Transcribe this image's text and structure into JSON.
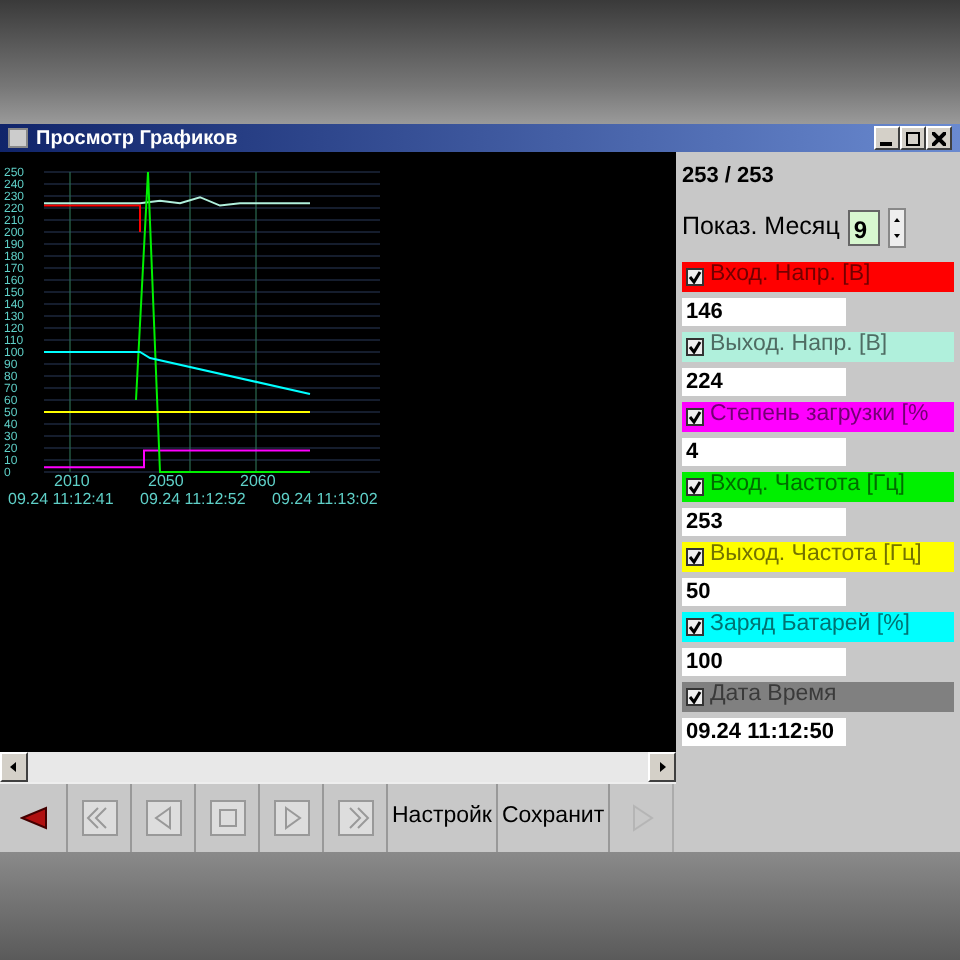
{
  "window": {
    "title": "Просмотр Графиков"
  },
  "chart": {
    "y_labels": [
      "250",
      "240",
      "230",
      "220",
      "210",
      "200",
      "190",
      "180",
      "170",
      "160",
      "150",
      "140",
      "130",
      "120",
      "110",
      "100",
      "90",
      "80",
      "70",
      "60",
      "50",
      "40",
      "30",
      "20",
      "10",
      "0"
    ],
    "x_labels": [
      "2010",
      "2050",
      "2060"
    ],
    "time_labels": [
      "09.24 11:12:41",
      "09.24 11:12:52",
      "09.24 11:13:02"
    ]
  },
  "counter": "253 / 253",
  "month": {
    "label": "Показ. Месяц",
    "value": "9"
  },
  "channels": [
    {
      "label": "Вход. Напр. [В]",
      "color": "#ff0000",
      "checked": true,
      "value": "146"
    },
    {
      "label": "Выход. Напр. [В]",
      "color": "#b0f0dc",
      "checked": true,
      "value": "224"
    },
    {
      "label": "Степень загрузки [%",
      "color": "#ff00ff",
      "checked": true,
      "value": "4"
    },
    {
      "label": "Вход. Частота [Гц]",
      "color": "#00f000",
      "checked": true,
      "value": "253"
    },
    {
      "label": "Выход. Частота [Гц]",
      "color": "#ffff00",
      "checked": true,
      "value": "50"
    },
    {
      "label": "Заряд Батарей [%]",
      "color": "#00ffff",
      "checked": true,
      "value": "100"
    },
    {
      "label": "Дата Время",
      "color": "#808080",
      "checked": true,
      "value": "09.24 11:12:50"
    }
  ],
  "toolbar": [
    {
      "kind": "back"
    },
    {
      "kind": "first"
    },
    {
      "kind": "prev"
    },
    {
      "kind": "stop"
    },
    {
      "kind": "next"
    },
    {
      "kind": "last"
    },
    {
      "kind": "text",
      "label": "Настройк"
    },
    {
      "kind": "text",
      "label": "Сохранит"
    },
    {
      "kind": "play",
      "disabled": true
    }
  ]
}
